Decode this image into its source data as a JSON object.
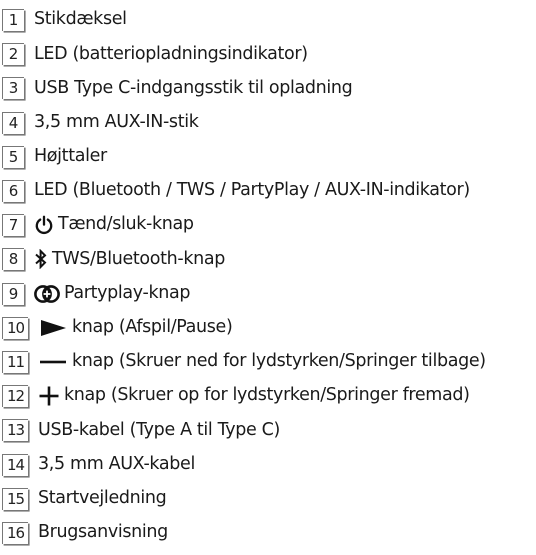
{
  "items": [
    {
      "number": "1",
      "label": "Stikdæksel",
      "icon": ""
    },
    {
      "number": "2",
      "label": "LED (batteriopladningsindikator)",
      "icon": ""
    },
    {
      "number": "3",
      "label": "USB Type C-indgangsstik til opladning",
      "icon": ""
    },
    {
      "number": "4",
      "label": "3,5 mm AUX-IN-stik",
      "icon": ""
    },
    {
      "number": "5",
      "label": "Højttaler",
      "icon": ""
    },
    {
      "number": "6",
      "label": "LED (Bluetooth / TWS / PartyPlay / AUX-IN-indikator)",
      "icon": ""
    },
    {
      "number": "7",
      "label": "Tænd/sluk-knap",
      "icon": "power-icon"
    },
    {
      "number": "8",
      "label": "TWS/Bluetooth-knap",
      "icon": "bluetooth-icon"
    },
    {
      "number": "9",
      "label": "Partyplay-knap",
      "icon": "partyplay-icon"
    },
    {
      "number": "10",
      "label": "knap (Afspil/Pause)",
      "icon": "play-icon"
    },
    {
      "number": "11",
      "label": "knap (Skruer ned for lydstyrken/Springer tilbage)",
      "icon": "minus-icon"
    },
    {
      "number": "12",
      "label": "knap (Skruer op for lydstyrken/Springer fremad)",
      "icon": "plus-icon"
    },
    {
      "number": "13",
      "label": "USB-kabel (Type A til Type C)",
      "icon": ""
    },
    {
      "number": "14",
      "label": "3,5 mm AUX-kabel",
      "icon": ""
    },
    {
      "number": "15",
      "label": "Startvejledning",
      "icon": ""
    },
    {
      "number": "16",
      "label": "Brugsanvisning",
      "icon": ""
    }
  ]
}
